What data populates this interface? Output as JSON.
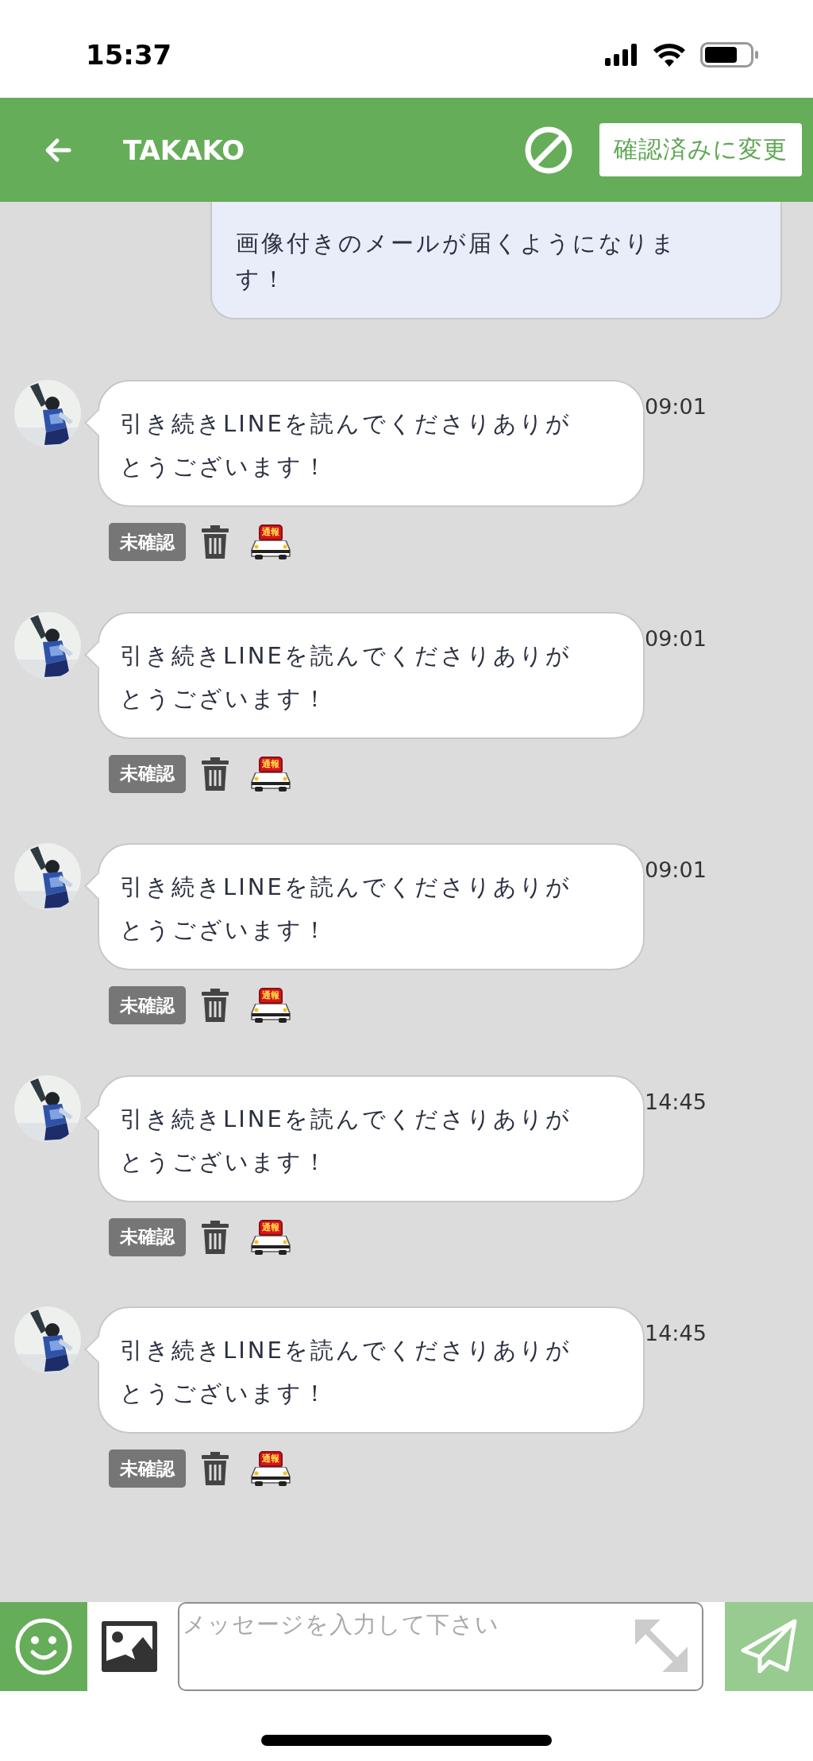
{
  "status_bar": {
    "time": "15:37"
  },
  "header": {
    "title": "TAKAKO",
    "confirm_button": "確認済みに変更"
  },
  "messages": [
    {
      "kind": "outgoing",
      "text": "画像付きのメールが届くようになります！"
    },
    {
      "kind": "incoming",
      "text": "引き続きLINEを読んでくださりありがとうございます！",
      "time": "09:01",
      "status": "未確認",
      "report": "通報"
    },
    {
      "kind": "incoming",
      "text": "引き続きLINEを読んでくださりありがとうございます！",
      "time": "09:01",
      "status": "未確認",
      "report": "通報"
    },
    {
      "kind": "incoming",
      "text": "引き続きLINEを読んでくださりありがとうございます！",
      "time": "09:01",
      "status": "未確認",
      "report": "通報"
    },
    {
      "kind": "incoming",
      "text": "引き続きLINEを読んでくださりありがとうございます！",
      "time": "14:45",
      "status": "未確認",
      "report": "通報"
    },
    {
      "kind": "incoming",
      "text": "引き続きLINEを読んでくださりありがとうございます！",
      "time": "14:45",
      "status": "未確認",
      "report": "通報"
    }
  ],
  "composer": {
    "placeholder": "メッセージを入力して下さい"
  }
}
